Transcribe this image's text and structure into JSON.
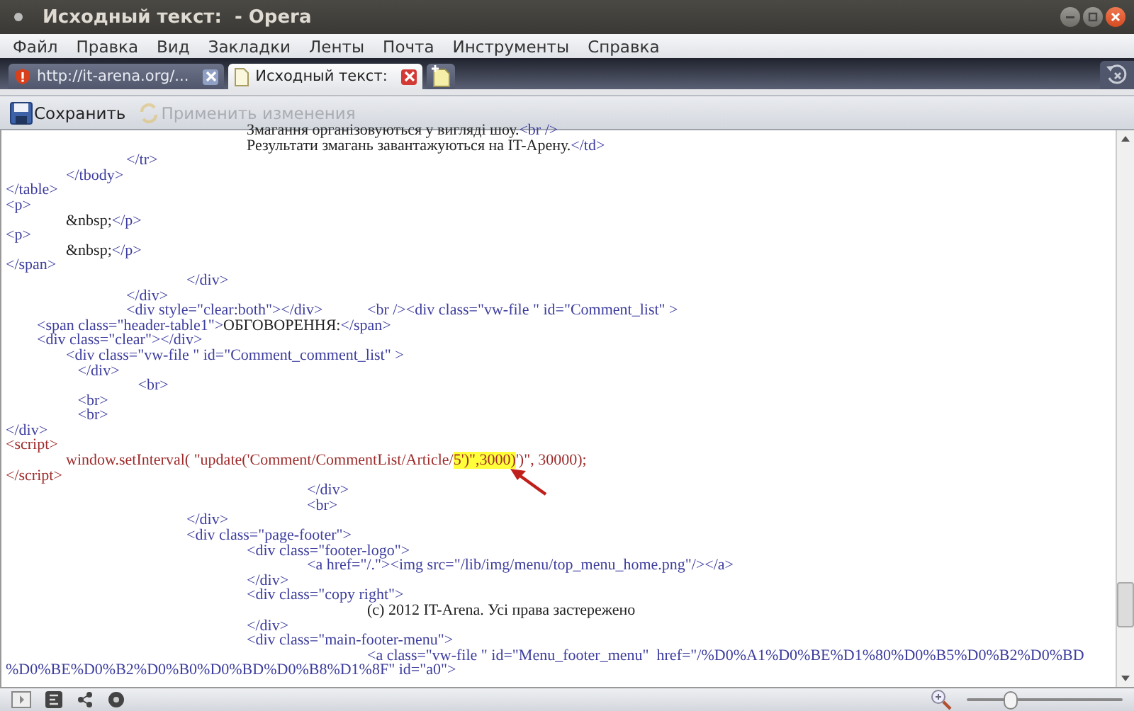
{
  "window": {
    "title": "Исходный текст:  - Opera"
  },
  "menu": [
    "Файл",
    "Правка",
    "Вид",
    "Закладки",
    "Ленты",
    "Почта",
    "Инструменты",
    "Справка"
  ],
  "tabs": [
    {
      "label": "http://it-arena.org/...",
      "selected": false
    },
    {
      "label": "Исходный текст:",
      "selected": true
    }
  ],
  "toolbar": [
    {
      "label": "Сохранить",
      "disabled": false
    },
    {
      "label": "Применить изменения",
      "disabled": true
    }
  ],
  "source": [
    {
      "parts": [
        {
          "kind": "text",
          "text": "\t\t\t\tЗмагання організовуються у вигляді шоу."
        },
        {
          "kind": "tag",
          "text": "<br />"
        }
      ]
    },
    {
      "parts": [
        {
          "kind": "text",
          "text": "\t\t\t\tРезультати змагань завантажуються на IT-Арену."
        },
        {
          "kind": "tag",
          "text": "</td>"
        }
      ]
    },
    {
      "parts": [
        {
          "kind": "tag",
          "text": "\t\t</tr>"
        }
      ]
    },
    {
      "parts": [
        {
          "kind": "tag",
          "text": "\t</tbody>"
        }
      ]
    },
    {
      "parts": [
        {
          "kind": "tag",
          "text": "</table>"
        }
      ]
    },
    {
      "parts": [
        {
          "kind": "tag",
          "text": "<p>"
        }
      ]
    },
    {
      "parts": [
        {
          "kind": "text",
          "text": "\t&nbsp;"
        },
        {
          "kind": "tag",
          "text": "</p>"
        }
      ]
    },
    {
      "parts": [
        {
          "kind": "tag",
          "text": "<p>"
        }
      ]
    },
    {
      "parts": [
        {
          "kind": "text",
          "text": "\t&nbsp;"
        },
        {
          "kind": "tag",
          "text": "</p>"
        }
      ]
    },
    {
      "parts": [
        {
          "kind": "tag",
          "text": "</span>"
        }
      ]
    },
    {
      "parts": [
        {
          "kind": "tag",
          "text": "\t\t\t</div>"
        }
      ]
    },
    {
      "parts": [
        {
          "kind": "tag",
          "text": "\t\t</div>"
        }
      ]
    },
    {
      "parts": [
        {
          "kind": "tag",
          "text": "\t\t<div style=\"clear:both\"></div>\t<br /><div class=\"vw-file \" id=\"Comment_list\" >"
        }
      ]
    },
    {
      "parts": [
        {
          "kind": "tag",
          "text": "        <span class=\"header-table1\">"
        },
        {
          "kind": "text",
          "text": "ОБГОВОРЕННЯ:"
        },
        {
          "kind": "tag",
          "text": "</span>"
        }
      ]
    },
    {
      "parts": [
        {
          "kind": "tag",
          "text": "        <div class=\"clear\"></div>"
        }
      ]
    },
    {
      "parts": [
        {
          "kind": "tag",
          "text": "\t<div class=\"vw-file \" id=\"Comment_comment_list\" >"
        }
      ]
    },
    {
      "parts": [
        {
          "kind": "tag",
          "text": "\t   </div>"
        }
      ]
    },
    {
      "parts": [
        {
          "kind": "tag",
          "text": "\t\t   <br>"
        }
      ]
    },
    {
      "parts": [
        {
          "kind": "tag",
          "text": "\t   <br>"
        }
      ]
    },
    {
      "parts": [
        {
          "kind": "tag",
          "text": "\t   <br>"
        }
      ]
    },
    {
      "parts": [
        {
          "kind": "tag",
          "text": "</div>"
        }
      ]
    },
    {
      "parts": [
        {
          "kind": "script",
          "text": "<script>"
        }
      ]
    },
    {
      "parts": [
        {
          "kind": "script",
          "text": "\twindow.setInterval( \"update('Comment/CommentList/Article/"
        },
        {
          "kind": "highlight",
          "text": "5')\",3000)"
        },
        {
          "kind": "script",
          "text": "')\", 30000);"
        }
      ]
    },
    {
      "parts": [
        {
          "kind": "script",
          "text": "</script>"
        }
      ]
    },
    {
      "parts": [
        {
          "kind": "tag",
          "text": "\t\t\t\t\t</div>"
        }
      ]
    },
    {
      "parts": [
        {
          "kind": "tag",
          "text": "\t\t\t\t\t<br>"
        }
      ]
    },
    {
      "parts": [
        {
          "kind": "tag",
          "text": "\t\t\t</div>"
        }
      ]
    },
    {
      "parts": [
        {
          "kind": "tag",
          "text": "\t\t\t<div class=\"page-footer\">"
        }
      ]
    },
    {
      "parts": [
        {
          "kind": "tag",
          "text": "\t\t\t\t<div class=\"footer-logo\">"
        }
      ]
    },
    {
      "parts": [
        {
          "kind": "tag",
          "text": "\t\t\t\t\t<a href=\"/.\"><img src=\"/lib/img/menu/top_menu_home.png\"/></a>"
        }
      ]
    },
    {
      "parts": [
        {
          "kind": "tag",
          "text": "\t\t\t\t</div>"
        }
      ]
    },
    {
      "parts": [
        {
          "kind": "tag",
          "text": "\t\t\t\t<div class=\"copy right\">"
        }
      ]
    },
    {
      "parts": [
        {
          "kind": "text",
          "text": "\t\t\t\t\t\t(c) 2012 IT-Arena. Усі права застережено"
        }
      ]
    },
    {
      "parts": [
        {
          "kind": "tag",
          "text": "\t\t\t\t</div>"
        }
      ]
    },
    {
      "parts": [
        {
          "kind": "tag",
          "text": "\t\t\t\t<div class=\"main-footer-menu\">"
        }
      ]
    },
    {
      "parts": [
        {
          "kind": "tag",
          "text": "\t\t\t\t\t\t<a class=\"vw-file \" id=\"Menu_footer_menu\"  href=\"/%D0%A1%D0%BE%D1%80%D0%B5%D0%B2%D0%BD"
        }
      ]
    },
    {
      "parts": [
        {
          "kind": "tag",
          "text": "%D0%BE%D0%B2%D0%B0%D0%BD%D0%B8%D1%8F\" id=\"a0\">"
        }
      ]
    }
  ],
  "zoom": {
    "level": 0.27
  }
}
